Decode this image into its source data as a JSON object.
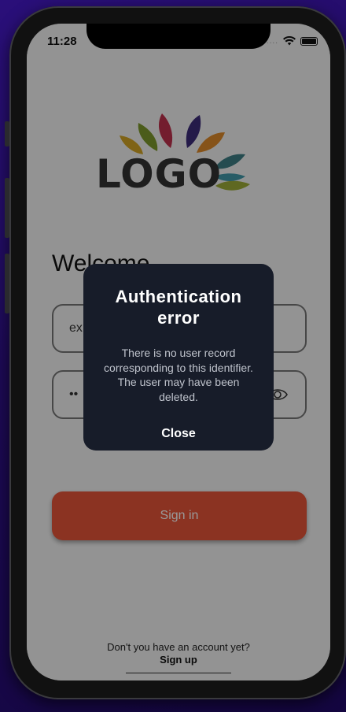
{
  "status_bar": {
    "time": "11:28",
    "signal": "....",
    "wifi_icon": "wifi-icon",
    "battery_icon": "battery-icon"
  },
  "logo": {
    "text": "LOGO"
  },
  "welcome": "Welcome",
  "email_field": {
    "value": "ex"
  },
  "password_field": {
    "value": "••"
  },
  "signin": {
    "label": "Sign in",
    "color": "#e8553a"
  },
  "signup": {
    "question": "Don't you have an account yet?",
    "link": "Sign up"
  },
  "dialog": {
    "title": "Authentication error",
    "message": "There is no user record corresponding to this identifier. The user may have been deleted.",
    "close": "Close",
    "background": "#171c29"
  }
}
